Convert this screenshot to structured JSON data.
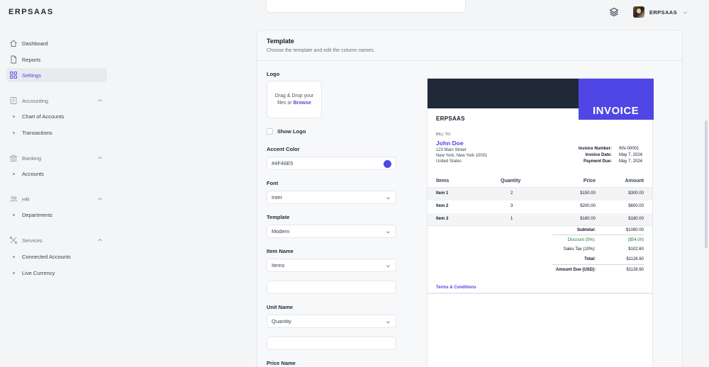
{
  "app": {
    "logo": "ERPSAAS"
  },
  "topbar": {
    "user_name": "ERPSAAS"
  },
  "sidebar": {
    "items": [
      {
        "label": "Dashboard"
      },
      {
        "label": "Reports"
      },
      {
        "label": "Settings"
      }
    ],
    "groups": [
      {
        "label": "Accounting",
        "children": [
          "Chart of Accounts",
          "Transactions"
        ]
      },
      {
        "label": "Banking",
        "children": [
          "Accounts"
        ]
      },
      {
        "label": "HR",
        "children": [
          "Departments"
        ]
      },
      {
        "label": "Services",
        "children": [
          "Connected Accounts",
          "Live Currency"
        ]
      }
    ]
  },
  "template_card": {
    "title": "Template",
    "subtitle": "Choose the template and edit the column names.",
    "logo_label": "Logo",
    "dropzone_line1": "Drag & Drop your",
    "dropzone_line2": "files or ",
    "dropzone_browse": "Browse",
    "show_logo_label": "Show Logo",
    "accent_color_label": "Accent Color",
    "accent_color_value": "#4F46E5",
    "accent_color": "#4f46e5",
    "font_label": "Font",
    "font_value": "Inter",
    "template_label": "Template",
    "template_value": "Modern",
    "item_name_label": "Item Name",
    "item_name_value": "Items",
    "unit_name_label": "Unit Name",
    "unit_name_value": "Quantity",
    "price_name_label": "Price Name"
  },
  "invoice": {
    "badge": "INVOICE",
    "company": "ERPSAAS",
    "bill_to_label": "BILL TO",
    "customer_name": "John Doe",
    "address_lines": [
      "123 Main Street",
      "New York, New York 10001",
      "United States"
    ],
    "meta": [
      {
        "label": "Invoice Number:",
        "value": "INV-00001"
      },
      {
        "label": "Invoice Date:",
        "value": "May 7, 2024"
      },
      {
        "label": "Payment Due:",
        "value": "May 7, 2024"
      }
    ],
    "columns": [
      "Items",
      "Quantity",
      "Price",
      "Amount"
    ],
    "rows": [
      {
        "item": "Item 1",
        "qty": "2",
        "price": "$150.00",
        "amount": "$300.00"
      },
      {
        "item": "Item 2",
        "qty": "3",
        "price": "$200.00",
        "amount": "$600.00"
      },
      {
        "item": "Item 3",
        "qty": "1",
        "price": "$180.00",
        "amount": "$180.00"
      }
    ],
    "totals": [
      {
        "label": "Subtotal:",
        "value": "$1080.00"
      },
      {
        "label": "Discount (5%):",
        "value": "($54.00)"
      },
      {
        "label": "Sales Tax (10%):",
        "value": "$102.60"
      },
      {
        "label": "Total:",
        "value": "$1128.60"
      },
      {
        "label": "Amount Due (USD):",
        "value": "$1128.60"
      }
    ],
    "terms_label": "Terms & Conditions"
  }
}
